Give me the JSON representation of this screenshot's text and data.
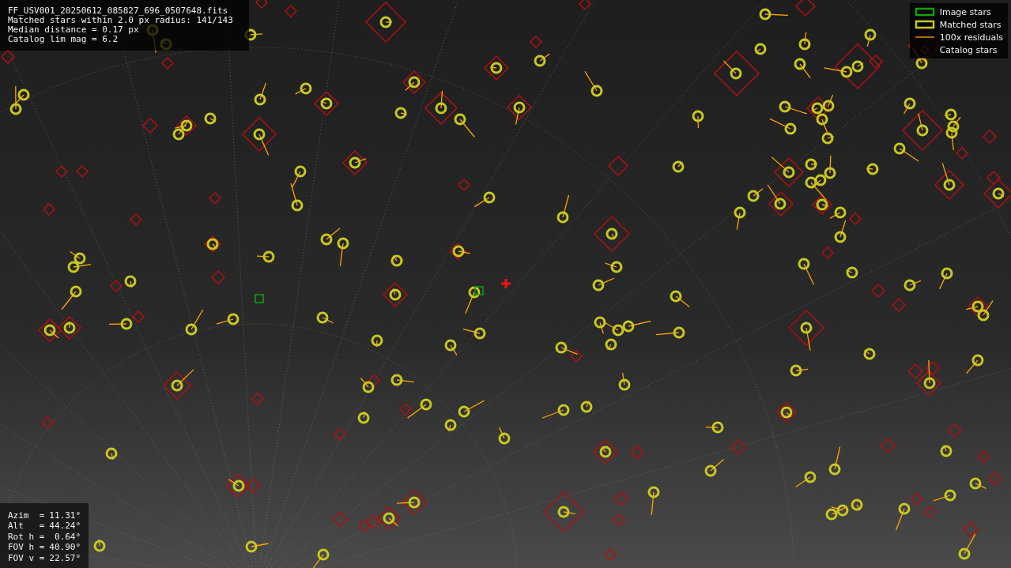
{
  "info_lines": [
    "FF_USV001_20250612_085827_696_0507648.fits",
    "Matched stars within 2.0 px radius: 141/143",
    "Median distance = 0.17 px",
    "Catalog lim mag = 6.2"
  ],
  "legend": [
    {
      "kind": "image",
      "label": "Image stars"
    },
    {
      "kind": "matched",
      "label": "Matched stars"
    },
    {
      "kind": "residual",
      "label": "100x residuals"
    },
    {
      "kind": "catalog",
      "label": "Catalog stars"
    }
  ],
  "pointing": [
    {
      "label": "Azim  =",
      "value": "11.31°"
    },
    {
      "label": "Alt   =",
      "value": "44.24°"
    },
    {
      "label": "Rot h =",
      "value": "0.64°"
    },
    {
      "label": "FOV h =",
      "value": "40.90°"
    },
    {
      "label": "FOV v =",
      "value": "22.57°"
    }
  ]
}
